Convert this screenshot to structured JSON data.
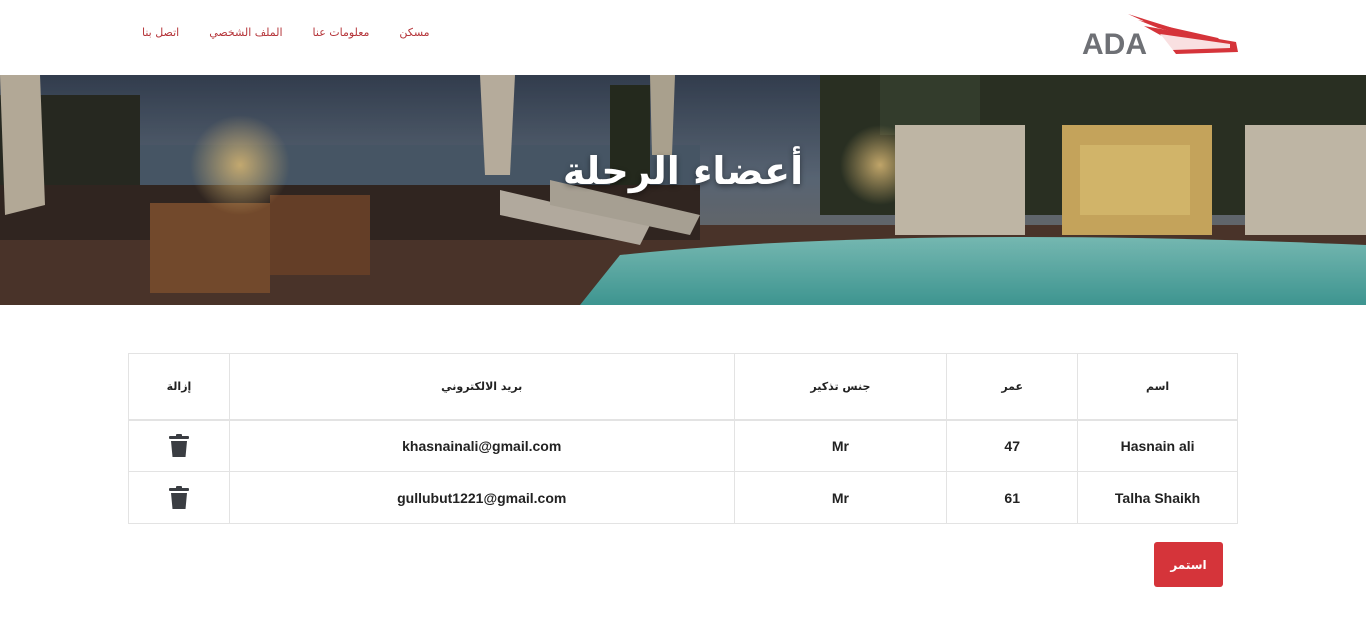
{
  "nav": {
    "items": [
      {
        "label": "مسكن"
      },
      {
        "label": "معلومات عنا"
      },
      {
        "label": "الملف الشخصي"
      },
      {
        "label": "اتصل بنا"
      }
    ]
  },
  "logo": {
    "text": "ADA"
  },
  "hero": {
    "title": "أعضاء الرحلة"
  },
  "table": {
    "headers": {
      "name": "اسم",
      "age": "عمر",
      "gender": "جنس تذكير",
      "email": "بريد الالكتروني",
      "remove": "إزالة"
    },
    "rows": [
      {
        "name": "Hasnain ali",
        "age": "47",
        "gender": "Mr",
        "email": "khasnainali@gmail.com"
      },
      {
        "name": "Talha Shaikh",
        "age": "61",
        "gender": "Mr",
        "email": "gullubut1221@gmail.com"
      }
    ]
  },
  "actions": {
    "continue_label": "استمر"
  },
  "colors": {
    "accent": "#d5343a",
    "nav_link": "#b5353a",
    "icon": "#3a3d42"
  }
}
